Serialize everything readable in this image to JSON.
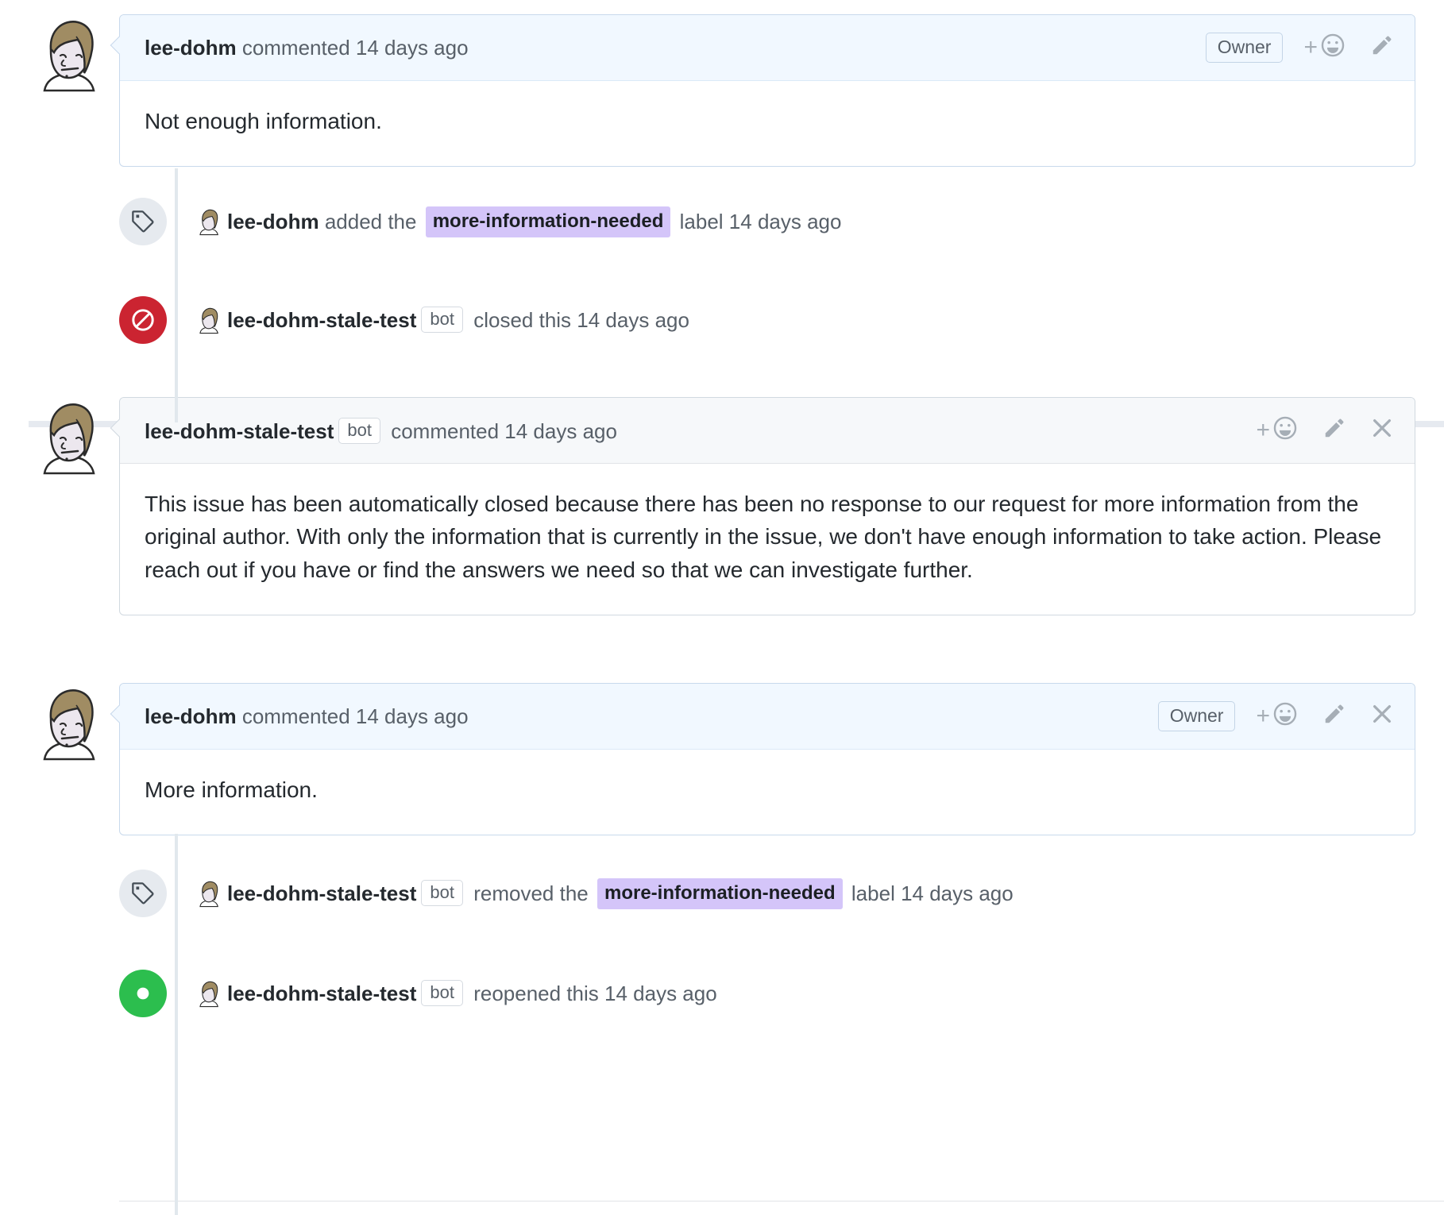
{
  "comments": [
    {
      "id": "comment-1",
      "author": "lee-dohm",
      "action": "commented 14 days ago",
      "badge": "Owner",
      "body": "Not enough information.",
      "style": "blue"
    },
    {
      "id": "comment-2",
      "author": "lee-dohm-stale-test",
      "bot_badge": "bot",
      "action": "commented 14 days ago",
      "body": "This issue has been automatically closed because there has been no response to our request for more information from the original author. With only the information that is currently in the issue, we don't have enough information to take action. Please reach out if you have or find the answers we need so that we can investigate further.",
      "style": "gray"
    },
    {
      "id": "comment-3",
      "author": "lee-dohm",
      "action": "commented 14 days ago",
      "badge": "Owner",
      "body": "More information.",
      "style": "blue"
    }
  ],
  "events": [
    {
      "id": "event-label-added",
      "icon": "tag-icon",
      "author": "lee-dohm",
      "verb": "added the",
      "label": "more-information-needed",
      "suffix": "label 14 days ago"
    },
    {
      "id": "event-closed",
      "icon": "circle-slash-icon",
      "author": "lee-dohm-stale-test",
      "bot_badge": "bot",
      "verb": "closed this 14 days ago"
    },
    {
      "id": "event-label-removed",
      "icon": "tag-icon",
      "author": "lee-dohm-stale-test",
      "bot_badge": "bot",
      "verb": "removed the",
      "label": "more-information-needed",
      "suffix": "label 14 days ago"
    },
    {
      "id": "event-reopened",
      "icon": "dot-fill-icon",
      "author": "lee-dohm-stale-test",
      "bot_badge": "bot",
      "verb": "reopened this 14 days ago"
    }
  ],
  "actions": {
    "add_reaction": "+",
    "edit": "edit-pencil",
    "close": "close-x"
  },
  "colors": {
    "label_purple": "#d4c5f9",
    "closed_red": "#cb2431",
    "reopened_green": "#2cbe4e",
    "comment_blue": "#f1f8ff",
    "comment_gray": "#f6f8fa",
    "border": "#d1d9e0",
    "rail": "#e1e8ed"
  }
}
